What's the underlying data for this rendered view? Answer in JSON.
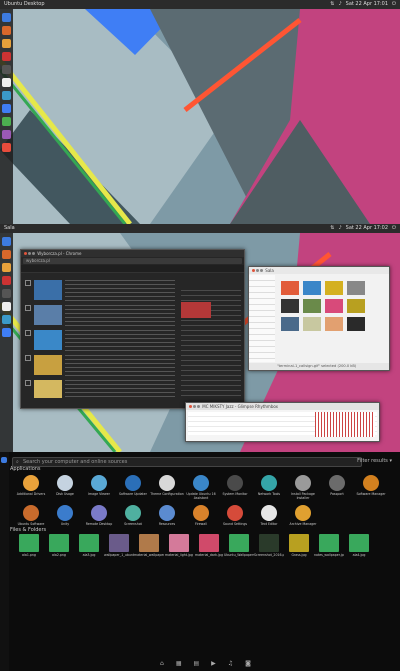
{
  "topbar1": {
    "title": "Ubuntu Desktop",
    "clock": "Sat 22 Apr 17:01"
  },
  "topbar2": {
    "title": "Sala",
    "clock": "Sat 22 Apr 17:02"
  },
  "topbar3": {
    "title": "",
    "clock": "Sat 22 Apr 17:02"
  },
  "browser": {
    "title": "Wyborcza.pl - Chrome",
    "url": "wyborcza.pl"
  },
  "filemanager": {
    "title": "Sala",
    "status": "\"terminal-1_callsign.gif\" selected (200.0 kB)"
  },
  "music": {
    "title": "MC MIKSTY Jazz - Glimpse Rhythmbox"
  },
  "dash": {
    "search_placeholder": "Search your computer and online sources",
    "filter_label": "Filter results ▾",
    "applications_label": "Applications",
    "apps_more": "See 48 more results",
    "files_label": "Files & Folders",
    "apps": [
      {
        "label": "Additional Drivers",
        "color": "#e9a23b"
      },
      {
        "label": "Disk Usage",
        "color": "#c5d3e0"
      },
      {
        "label": "Image Viewer",
        "color": "#5aa9d6"
      },
      {
        "label": "Software Updater",
        "color": "#2b6fb8"
      },
      {
        "label": "Theme Configuration",
        "color": "#d8d8d8"
      },
      {
        "label": "Update Ubuntu 16 Assistant",
        "color": "#3a86c8"
      },
      {
        "label": "System Monitor",
        "color": "#4a4a4a"
      },
      {
        "label": "Network Tools",
        "color": "#35a5a8"
      },
      {
        "label": "Install Package Installer",
        "color": "#9a9a9a"
      },
      {
        "label": "Passport",
        "color": "#6b6b6b"
      },
      {
        "label": "Software Manager",
        "color": "#d2801f"
      },
      {
        "label": "Ubuntu Software",
        "color": "#c96b2c"
      },
      {
        "label": "Unity",
        "color": "#3b7ccc"
      },
      {
        "label": "Remote Desktop",
        "color": "#7a7ac8"
      },
      {
        "label": "Screenshot",
        "color": "#4fb0a0"
      },
      {
        "label": "Resources",
        "color": "#5b8bd0"
      },
      {
        "label": "Firewall",
        "color": "#d9822b"
      },
      {
        "label": "Sound Settings",
        "color": "#d64b3a"
      },
      {
        "label": "Text Editor",
        "color": "#e6e6e6"
      },
      {
        "label": "Archive Manager",
        "color": "#e0a030"
      }
    ],
    "files": [
      {
        "label": "ala1.png",
        "color": "#39a85c"
      },
      {
        "label": "ala2.png",
        "color": "#39a85c"
      },
      {
        "label": "ala3.jpg",
        "color": "#39a85c"
      },
      {
        "label": "wallpaper_1_ubuntu.jpg",
        "color": "#6a5b8a"
      },
      {
        "label": "material_wallpaper_2.jpg",
        "color": "#b07a4a"
      },
      {
        "label": "material_light.jpg",
        "color": "#d47a9a"
      },
      {
        "label": "material_dark.jpg",
        "color": "#d04a6a"
      },
      {
        "label": "Ubuntu_Wallpapers",
        "color": "#39a85c"
      },
      {
        "label": "Screenshot_2016.png",
        "color": "#2a3a2a"
      },
      {
        "label": "Grass.jpg",
        "color": "#b8a020"
      },
      {
        "label": "notes_wallpaper.jpg",
        "color": "#39a85c"
      },
      {
        "label": "ala4.jpg",
        "color": "#39a85c"
      }
    ]
  }
}
